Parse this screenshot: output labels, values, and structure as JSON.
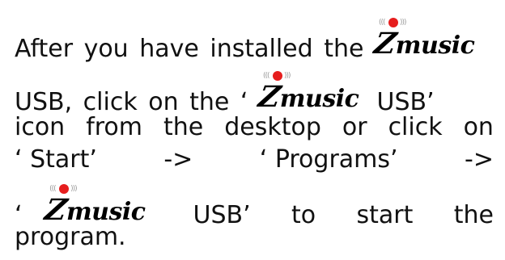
{
  "logo": {
    "text": "music",
    "initial": "Z",
    "accent_color": "#e61e1e"
  },
  "lines": {
    "l1_a": "After you have installed the",
    "l2_a": "USB, click on the ‘",
    "l2_b": "USB’",
    "l3_a": "icon",
    "l3_b": "from",
    "l3_c": "the",
    "l3_d": "desktop",
    "l3_e": "or",
    "l3_f": "click",
    "l3_g": "on",
    "l4_a": "‘ Start’",
    "l4_b": "->",
    "l4_c": "‘ Programs’",
    "l4_d": "->",
    "l5_a": "‘",
    "l5_b": "USB’",
    "l5_c": "to",
    "l5_d": "start",
    "l5_e": "the",
    "l6_a": "program."
  }
}
